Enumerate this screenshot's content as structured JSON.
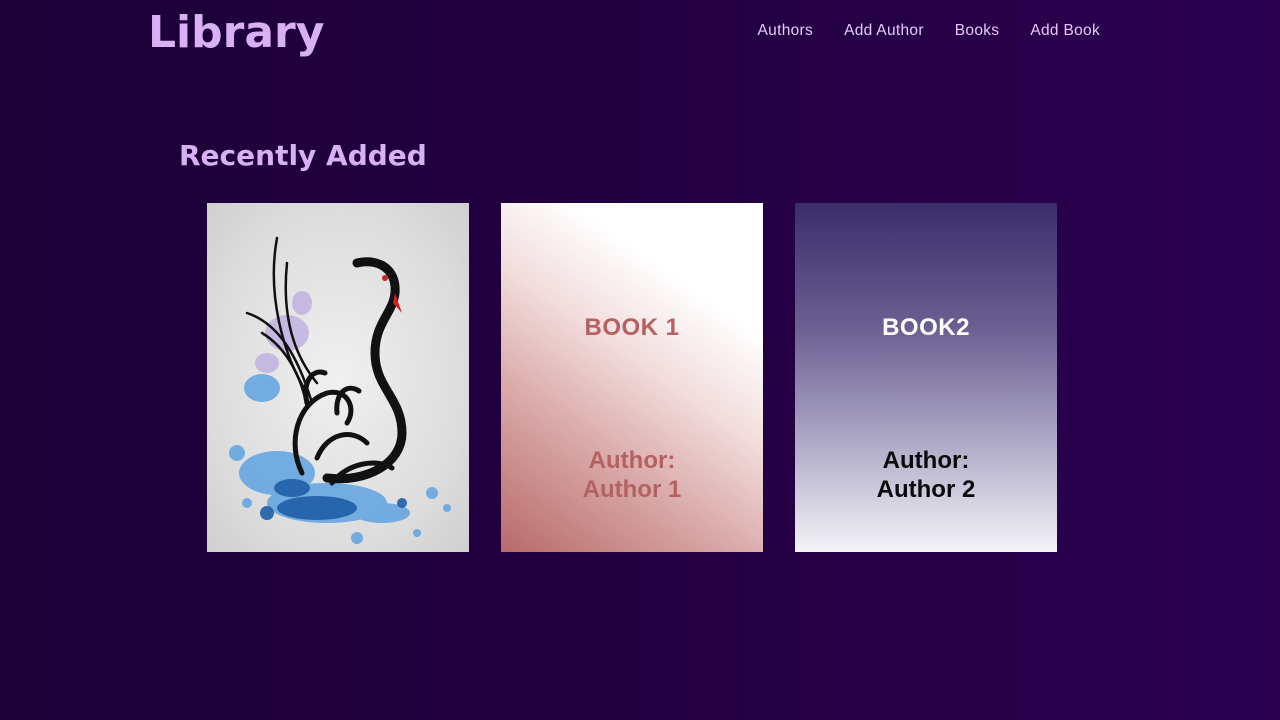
{
  "app": {
    "title": "Library"
  },
  "nav": {
    "items": [
      {
        "label": "Authors"
      },
      {
        "label": "Add Author"
      },
      {
        "label": "Books"
      },
      {
        "label": "Add Book"
      }
    ]
  },
  "main": {
    "section_title": "Recently Added",
    "books": [
      {
        "cover": "swan-calligraphy-cover"
      },
      {
        "cover_title": "BOOK 1",
        "cover_author": "Author:\nAuthor 1"
      },
      {
        "cover_title": "BOOK2",
        "cover_author": "Author:\nAuthor 2"
      }
    ]
  },
  "colors": {
    "background": "#22003f",
    "accent": "#dab0f5",
    "nav_text": "#e6c8f5"
  }
}
